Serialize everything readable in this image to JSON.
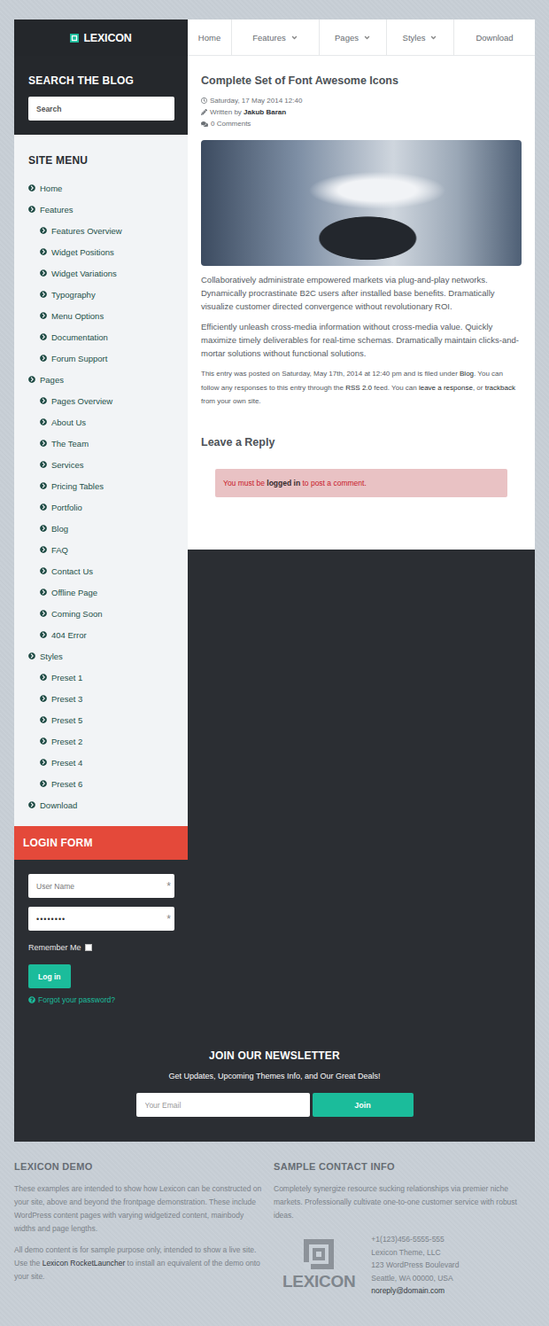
{
  "logo": {
    "text": "LEXICON"
  },
  "nav": [
    {
      "label": "Home",
      "has_menu": false
    },
    {
      "label": "Features",
      "has_menu": true
    },
    {
      "label": "Pages",
      "has_menu": true
    },
    {
      "label": "Styles",
      "has_menu": true
    },
    {
      "label": "Download",
      "has_menu": false
    }
  ],
  "search": {
    "title": "SEARCH THE BLOG",
    "placeholder": "Search"
  },
  "site_menu": {
    "title": "SITE MENU",
    "items": [
      {
        "label": "Home",
        "kind": "top"
      },
      {
        "label": "Features",
        "kind": "top"
      },
      {
        "label": "Features Overview",
        "kind": "sub"
      },
      {
        "label": "Widget Positions",
        "kind": "sub"
      },
      {
        "label": "Widget Variations",
        "kind": "sub"
      },
      {
        "label": "Typography",
        "kind": "sub"
      },
      {
        "label": "Menu Options",
        "kind": "sub"
      },
      {
        "label": "Documentation",
        "kind": "sub"
      },
      {
        "label": "Forum Support",
        "kind": "sub"
      },
      {
        "label": "Pages",
        "kind": "top"
      },
      {
        "label": "Pages Overview",
        "kind": "sub"
      },
      {
        "label": "About Us",
        "kind": "sub"
      },
      {
        "label": "The Team",
        "kind": "sub"
      },
      {
        "label": "Services",
        "kind": "sub"
      },
      {
        "label": "Pricing Tables",
        "kind": "sub"
      },
      {
        "label": "Portfolio",
        "kind": "sub"
      },
      {
        "label": "Blog",
        "kind": "sub"
      },
      {
        "label": "FAQ",
        "kind": "sub"
      },
      {
        "label": "Contact Us",
        "kind": "sub"
      },
      {
        "label": "Offline Page",
        "kind": "sub"
      },
      {
        "label": "Coming Soon",
        "kind": "sub"
      },
      {
        "label": "404 Error",
        "kind": "sub"
      },
      {
        "label": "Styles",
        "kind": "top"
      },
      {
        "label": "Preset 1",
        "kind": "sub"
      },
      {
        "label": "Preset 3",
        "kind": "sub"
      },
      {
        "label": "Preset 5",
        "kind": "sub"
      },
      {
        "label": "Preset 2",
        "kind": "sub"
      },
      {
        "label": "Preset 4",
        "kind": "sub"
      },
      {
        "label": "Preset 6",
        "kind": "sub"
      },
      {
        "label": "Download",
        "kind": "top"
      }
    ]
  },
  "login": {
    "title": "LOGIN FORM",
    "username_placeholder": "User Name",
    "password_value": "••••••••",
    "required_mark": "*",
    "remember_label": "Remember Me",
    "remember_checked": false,
    "button": "Log in",
    "forgot": "Forgot your password?"
  },
  "post": {
    "title": "Complete Set of Font Awesome Icons",
    "date": "Saturday, 17 May 2014 12:40",
    "written_by": "Written by ",
    "author": "Jakub Baran",
    "comments": "0 Comments",
    "paragraphs": [
      "Collaboratively administrate empowered markets via plug-and-play networks. Dynamically procrastinate B2C users after installed base benefits. Dramatically visualize customer directed convergence without revolutionary ROI.",
      "Efficiently unleash cross-media information without cross-media value. Quickly maximize timely deliverables for real-time schemas. Dramatically maintain clicks-and-mortar solutions without functional solutions."
    ],
    "entry_meta": [
      {
        "text": "This entry was posted on Saturday, May 17th, 2014 at 12:40 pm and is filed under ",
        "link": false
      },
      {
        "text": "Blog",
        "link": true
      },
      {
        "text": ". You can follow any responses to this entry through the ",
        "link": false
      },
      {
        "text": "RSS 2.0",
        "link": true
      },
      {
        "text": " feed. You can ",
        "link": false
      },
      {
        "text": "leave a response",
        "link": true
      },
      {
        "text": ", or ",
        "link": false
      },
      {
        "text": "trackback",
        "link": true
      },
      {
        "text": " from your own site.",
        "link": false
      }
    ]
  },
  "reply": {
    "title": "Leave a Reply",
    "notice": [
      {
        "text": "You must be ",
        "link": false
      },
      {
        "text": "logged in",
        "link": true
      },
      {
        "text": " to post a comment.",
        "link": false
      }
    ]
  },
  "newsletter": {
    "title": "JOIN OUR NEWSLETTER",
    "subtitle": "Get Updates, Upcoming Themes Info, and Our Great Deals!",
    "placeholder": "Your Email",
    "button": "Join"
  },
  "footer": {
    "demo": {
      "title": "LEXICON DEMO",
      "paragraphs": [
        [
          {
            "text": "These examples are intended to show how Lexicon can be constructed on your site, above and beyond the frontpage demonstration. These include WordPress content pages with varying widgetized content, mainbody widths and page lengths.",
            "link": false
          }
        ],
        [
          {
            "text": "All demo content is for sample purpose only, intended to show a live site. Use the ",
            "link": false
          },
          {
            "text": "Lexicon RocketLauncher",
            "link": true
          },
          {
            "text": " to install an equivalent of the demo onto your site.",
            "link": false
          }
        ]
      ]
    },
    "contact": {
      "title": "SAMPLE CONTACT INFO",
      "text": "Completely synergize resource sucking relationships via premier niche markets. Professionally cultivate one-to-one customer service with robust ideas.",
      "logo": "LEXICON",
      "lines": [
        {
          "text": "+1(123)456-5555-555",
          "link": false
        },
        {
          "text": "Lexicon Theme, LLC",
          "link": false
        },
        {
          "text": "123 WordPress Boulevard",
          "link": false
        },
        {
          "text": "Seattle, WA 00000, USA",
          "link": false
        },
        {
          "text": "noreply@domain.com",
          "link": true
        }
      ]
    }
  }
}
